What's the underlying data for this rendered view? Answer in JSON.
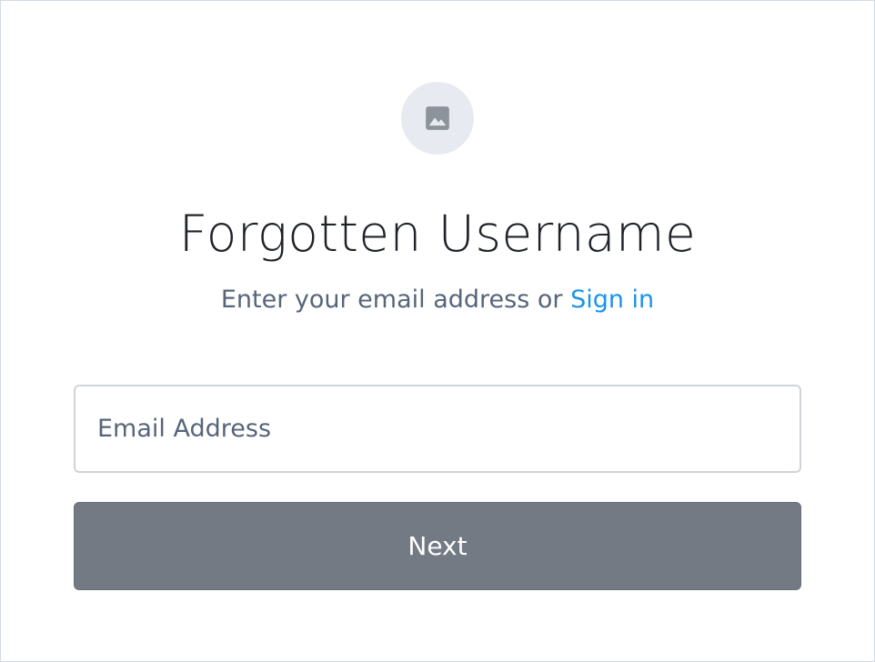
{
  "header": {
    "logo_icon": "image-placeholder-icon",
    "title": "Forgotten Username",
    "subtitle_text": "Enter your email address or ",
    "signin_link": "Sign in"
  },
  "form": {
    "email_placeholder": "Email Address",
    "email_value": "",
    "next_label": "Next"
  },
  "colors": {
    "link": "#1b94ea",
    "button": "#737a84",
    "logo_bg": "#e7eaf0"
  }
}
